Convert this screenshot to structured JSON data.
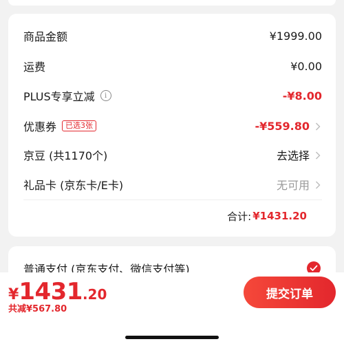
{
  "summary": {
    "goods_amount": {
      "label": "商品金额",
      "value": "¥1999.00"
    },
    "shipping": {
      "label": "运费",
      "value": "¥0.00"
    },
    "plus_discount": {
      "label": "PLUS专享立减",
      "info_icon": "i",
      "value": "-¥8.00"
    },
    "coupon": {
      "label": "优惠券",
      "badge": "已选3张",
      "value": "-¥559.80"
    },
    "jd_beans": {
      "label": "京豆 (共1170个)",
      "value": "去选择"
    },
    "gift_card": {
      "label": "礼品卡 (京东卡/E卡)",
      "value": "无可用"
    },
    "total": {
      "label": "合计:",
      "value": "¥1431.20"
    }
  },
  "payment": {
    "label": "普通支付 (京东支付、微信支付等)",
    "selected": true
  },
  "bottom_bar": {
    "currency": "¥",
    "price_int": "1431",
    "price_dec": ".20",
    "saved_text": "共减¥567.80",
    "submit_label": "提交订单"
  },
  "colors": {
    "accent": "#e3272d",
    "background": "#f2f2f2",
    "card": "#ffffff"
  },
  "icons": {
    "chevron": "chevron-right-icon",
    "info": "info-icon",
    "check": "check-circle-icon"
  }
}
